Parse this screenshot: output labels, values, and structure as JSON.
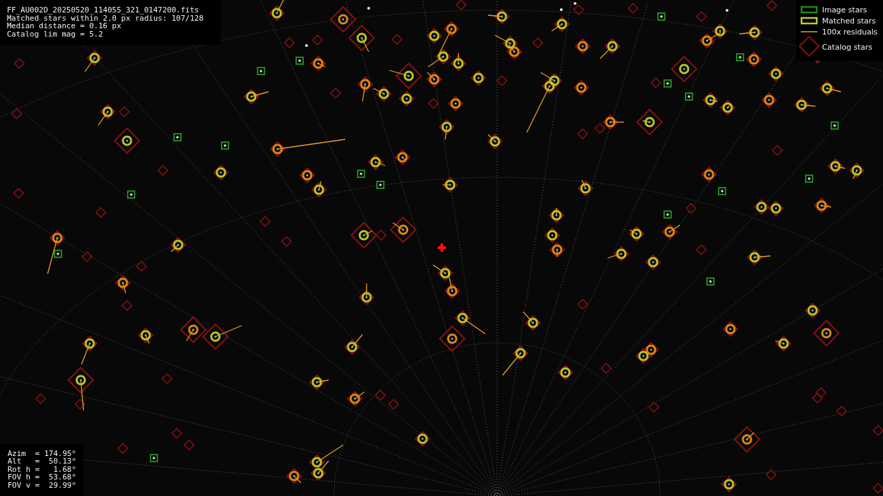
{
  "info_lines": [
    "FF_AU002D_20250520_114055_321_0147200.fits",
    "Matched stars within 2.0 px radius: 107/128",
    "Median distance = 0.16 px",
    "Catalog lim mag = 5.2"
  ],
  "legend": [
    {
      "kind": "image",
      "label": "Image stars"
    },
    {
      "kind": "matched",
      "label": "Matched stars"
    },
    {
      "kind": "residual",
      "label": "100x residuals"
    },
    {
      "kind": "catalog",
      "label": "Catalog stars"
    }
  ],
  "pointing_lines": [
    "Azim  = 174.95°",
    "Alt   =  50.13°",
    "Rot h =   1.68°",
    "FOV h =  53.68°",
    "FOV v =  29.99°"
  ]
}
